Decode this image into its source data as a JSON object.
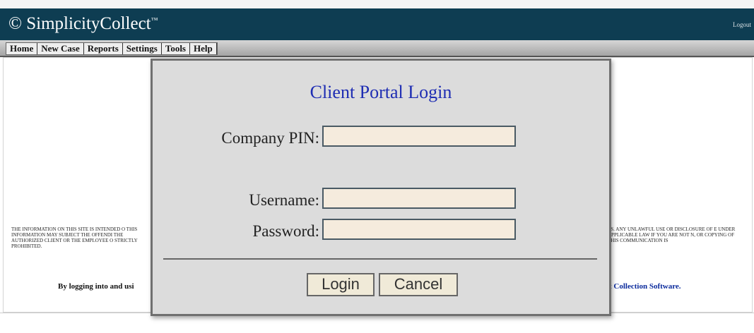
{
  "app": {
    "title": "SimplicityCollect",
    "trademark": "™",
    "logo_glyph": "©",
    "logout": "Logout"
  },
  "nav": {
    "items": [
      "Home",
      "New Case",
      "Reports",
      "Settings",
      "Tools",
      "Help"
    ]
  },
  "disclaimer": {
    "left": "THE INFORMATION ON THIS SITE IS INTENDED O THIS INFORMATION MAY SUBJECT THE OFFENDI THE AUTHORIZED CLIENT OR THE EMPLOYEE O STRICTLY PROHIBITED.",
    "right": "ES. ANY UNLAWFUL USE OR DISCLOSURE OF E UNDER APPLICABLE LAW IF YOU ARE NOT N, OR COPYING OF THIS COMMUNICATION IS",
    "agree_left": "By logging into and usi",
    "agree_right": "t Collection Software."
  },
  "login": {
    "title": "Client Portal Login",
    "company_pin_label": "Company PIN:",
    "company_pin_value": "",
    "username_label": "Username:",
    "username_value": "",
    "password_label": "Password:",
    "password_value": "",
    "login_button": "Login",
    "cancel_button": "Cancel"
  },
  "colors": {
    "header": "#0e3d52",
    "title": "#1e2db3",
    "input_bg": "#f5ebdd",
    "modal_bg": "#dcdcdc"
  }
}
